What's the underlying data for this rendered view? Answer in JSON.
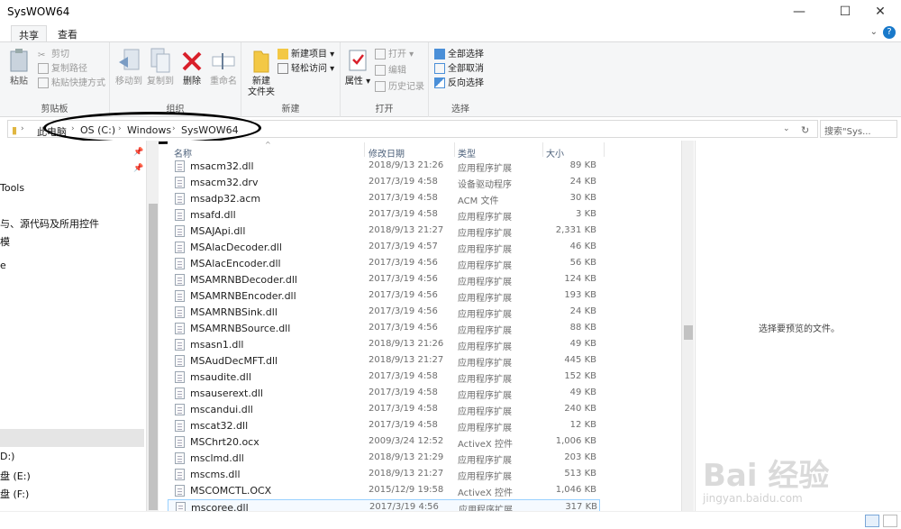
{
  "window": {
    "title": "SysWOW64",
    "min": "—",
    "max": "☐",
    "close": "✕"
  },
  "tabs": [
    {
      "label": "共享"
    },
    {
      "label": "查看"
    }
  ],
  "help": "?",
  "ribbon": {
    "clipboard": {
      "label": "剪贴板",
      "paste": "粘贴",
      "cut": "剪切",
      "copy_path": "复制路径",
      "paste_shortcut": "粘贴快捷方式"
    },
    "organize": {
      "label": "组织",
      "move_to": "移动到",
      "copy_to": "复制到",
      "delete": "删除",
      "rename": "重命名"
    },
    "new": {
      "label": "新建",
      "new_folder_line1": "新建",
      "new_folder_line2": "文件夹",
      "new_item": "新建项目",
      "easy_access": "轻松访问"
    },
    "open": {
      "label": "打开",
      "properties": "属性",
      "open": "打开",
      "edit": "编辑",
      "history": "历史记录"
    },
    "select": {
      "label": "选择",
      "select_all": "全部选择",
      "select_none": "全部取消",
      "invert": "反向选择"
    }
  },
  "address": {
    "crumbs": [
      "此电脑",
      "OS (C:)",
      "Windows",
      "SysWOW64"
    ],
    "search_placeholder": "搜索\"Sys..."
  },
  "nav": {
    "items": [
      "Tools",
      "与、源代码及所用控件",
      "模",
      "e",
      "D:)",
      "盘 (E:)",
      "盘 (F:)"
    ]
  },
  "columns": {
    "name": "名称",
    "date": "修改日期",
    "type": "类型",
    "size": "大小"
  },
  "files": [
    {
      "name": "msacm32.dll",
      "date": "2018/9/13 21:26",
      "type": "应用程序扩展",
      "size": "89 KB"
    },
    {
      "name": "msacm32.drv",
      "date": "2017/3/19 4:58",
      "type": "设备驱动程序",
      "size": "24 KB"
    },
    {
      "name": "msadp32.acm",
      "date": "2017/3/19 4:58",
      "type": "ACM 文件",
      "size": "30 KB"
    },
    {
      "name": "msafd.dll",
      "date": "2017/3/19 4:58",
      "type": "应用程序扩展",
      "size": "3 KB"
    },
    {
      "name": "MSAJApi.dll",
      "date": "2018/9/13 21:27",
      "type": "应用程序扩展",
      "size": "2,331 KB"
    },
    {
      "name": "MSAlacDecoder.dll",
      "date": "2017/3/19 4:57",
      "type": "应用程序扩展",
      "size": "46 KB"
    },
    {
      "name": "MSAlacEncoder.dll",
      "date": "2017/3/19 4:56",
      "type": "应用程序扩展",
      "size": "56 KB"
    },
    {
      "name": "MSAMRNBDecoder.dll",
      "date": "2017/3/19 4:56",
      "type": "应用程序扩展",
      "size": "124 KB"
    },
    {
      "name": "MSAMRNBEncoder.dll",
      "date": "2017/3/19 4:56",
      "type": "应用程序扩展",
      "size": "193 KB"
    },
    {
      "name": "MSAMRNBSink.dll",
      "date": "2017/3/19 4:56",
      "type": "应用程序扩展",
      "size": "24 KB"
    },
    {
      "name": "MSAMRNBSource.dll",
      "date": "2017/3/19 4:56",
      "type": "应用程序扩展",
      "size": "88 KB"
    },
    {
      "name": "msasn1.dll",
      "date": "2018/9/13 21:26",
      "type": "应用程序扩展",
      "size": "49 KB"
    },
    {
      "name": "MSAudDecMFT.dll",
      "date": "2018/9/13 21:27",
      "type": "应用程序扩展",
      "size": "445 KB"
    },
    {
      "name": "msaudite.dll",
      "date": "2017/3/19 4:58",
      "type": "应用程序扩展",
      "size": "152 KB"
    },
    {
      "name": "msauserext.dll",
      "date": "2017/3/19 4:58",
      "type": "应用程序扩展",
      "size": "49 KB"
    },
    {
      "name": "mscandui.dll",
      "date": "2017/3/19 4:58",
      "type": "应用程序扩展",
      "size": "240 KB"
    },
    {
      "name": "mscat32.dll",
      "date": "2017/3/19 4:58",
      "type": "应用程序扩展",
      "size": "12 KB"
    },
    {
      "name": "MSChrt20.ocx",
      "date": "2009/3/24 12:52",
      "type": "ActiveX 控件",
      "size": "1,006 KB"
    },
    {
      "name": "msclmd.dll",
      "date": "2018/9/13 21:29",
      "type": "应用程序扩展",
      "size": "203 KB"
    },
    {
      "name": "mscms.dll",
      "date": "2018/9/13 21:27",
      "type": "应用程序扩展",
      "size": "513 KB"
    },
    {
      "name": "MSCOMCTL.OCX",
      "date": "2015/12/9 19:58",
      "type": "ActiveX 控件",
      "size": "1,046 KB"
    },
    {
      "name": "mscoree.dll",
      "date": "2017/3/19 4:56",
      "type": "应用程序扩展",
      "size": "317 KB"
    }
  ],
  "preview": {
    "message": "选择要预览的文件。"
  },
  "watermark": {
    "main": "Bai 经验",
    "sub": "jingyan.baidu.com"
  }
}
